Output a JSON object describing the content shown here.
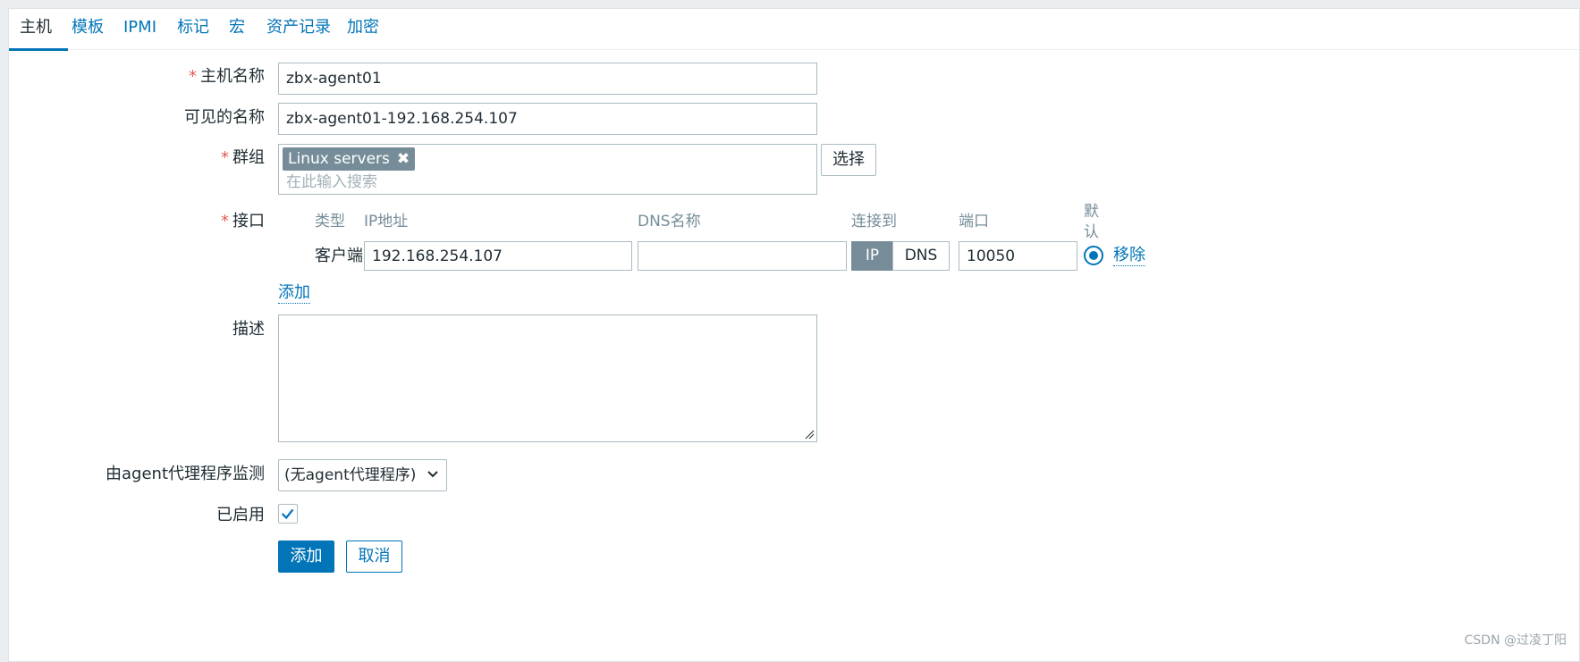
{
  "tabs": [
    "主机",
    "模板",
    "IPMI",
    "标记",
    "宏",
    "资产记录",
    "加密"
  ],
  "form": {
    "host_name": {
      "label": "主机名称",
      "value": "zbx-agent01"
    },
    "visible_name": {
      "label": "可见的名称",
      "value": "zbx-agent01-192.168.254.107"
    },
    "groups": {
      "label": "群组",
      "chip": "Linux servers",
      "placeholder": "在此输入搜索",
      "select_button": "选择"
    },
    "interfaces": {
      "label": "接口",
      "col_type": "类型",
      "col_ip": "IP地址",
      "col_dns": "DNS名称",
      "col_connect": "连接到",
      "col_port": "端口",
      "col_default_1": "默",
      "col_default_2": "认",
      "row": {
        "type": "客户端",
        "ip": "192.168.254.107",
        "dns": "",
        "connect_ip": "IP",
        "connect_dns": "DNS",
        "port": "10050",
        "remove": "移除"
      },
      "add": "添加"
    },
    "description": {
      "label": "描述",
      "value": ""
    },
    "proxy": {
      "label": "由agent代理程序监测",
      "value": "(无agent代理程序)"
    },
    "enabled": {
      "label": "已启用",
      "checked": true
    },
    "buttons": {
      "add": "添加",
      "cancel": "取消"
    }
  },
  "watermark": "CSDN @过凌丁阳",
  "colors": {
    "accent": "#0275b8",
    "required": "#e45959",
    "chip": "#768d99"
  }
}
